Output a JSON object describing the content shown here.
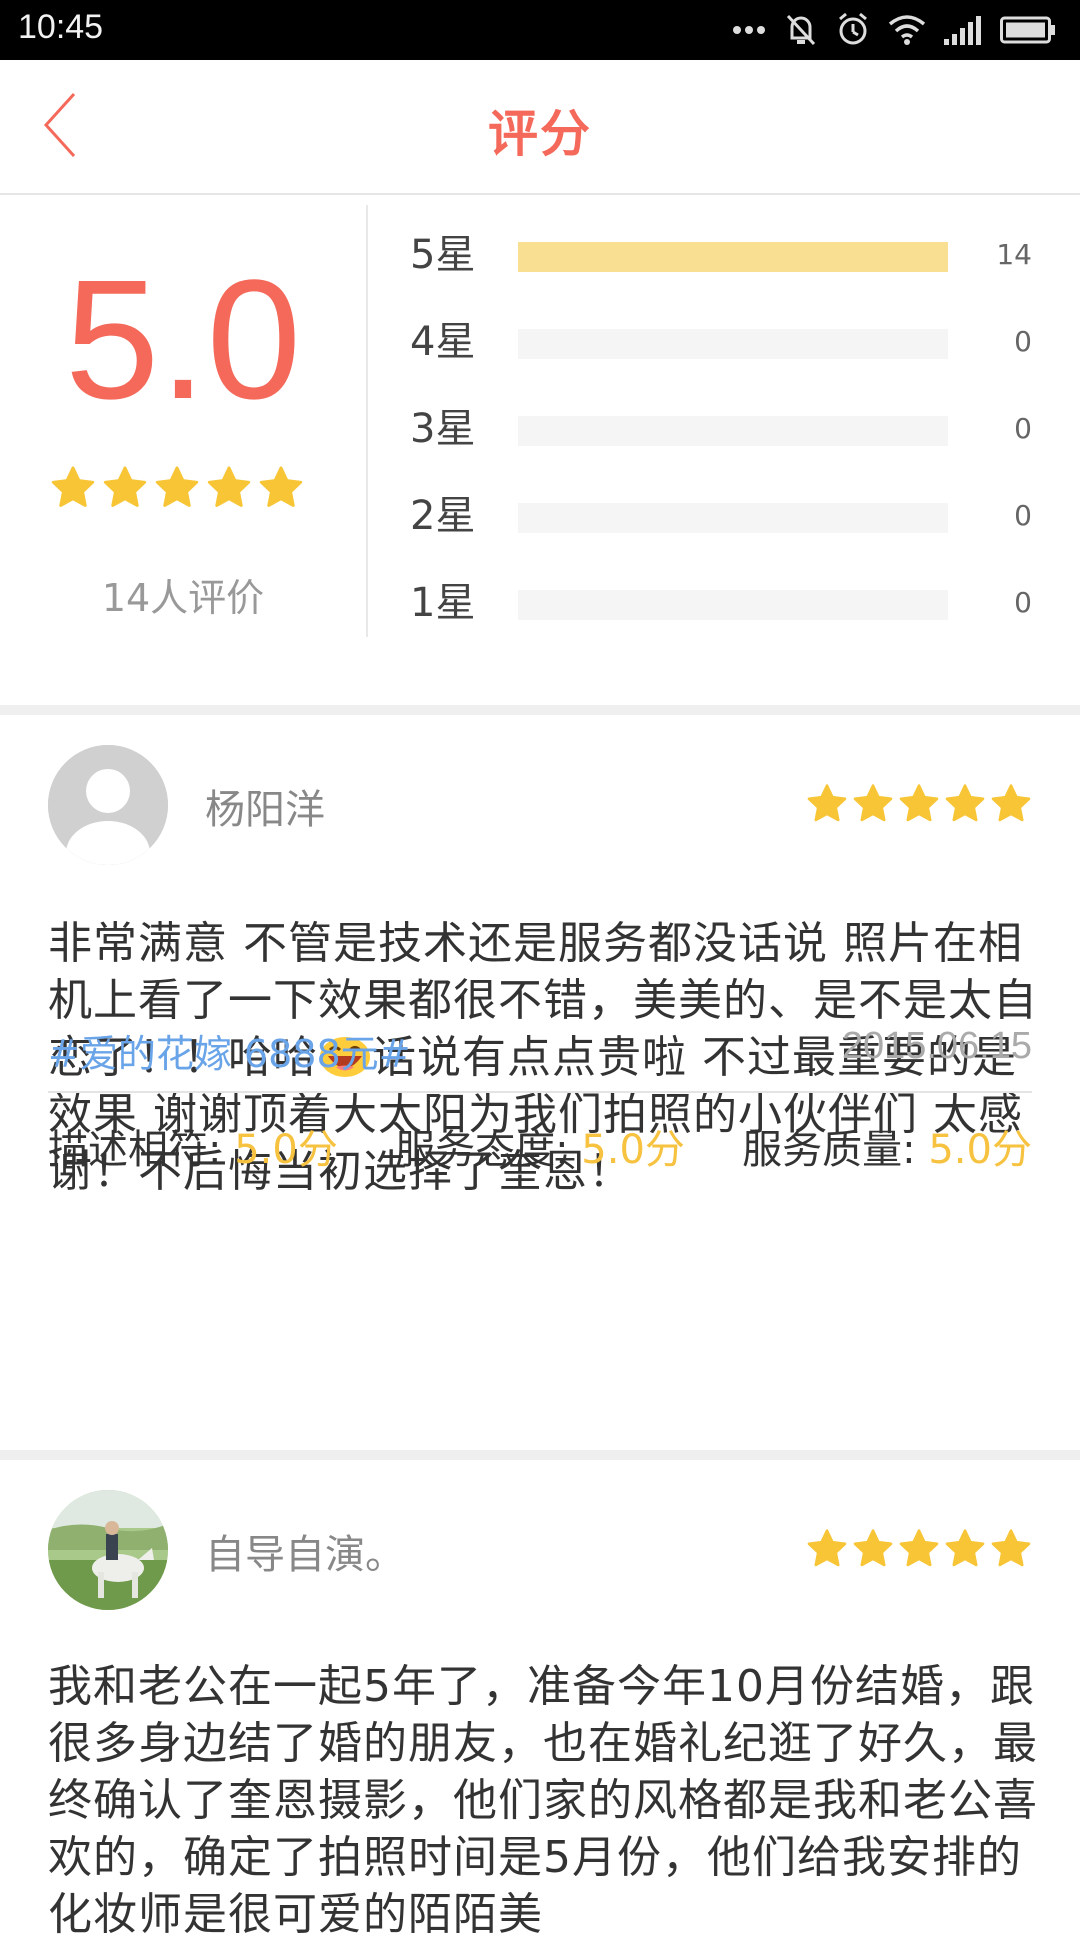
{
  "status_bar": {
    "time": "10:45"
  },
  "header": {
    "title": "评分"
  },
  "summary": {
    "average": "5.0",
    "review_count_text": "14人评价",
    "distribution": [
      {
        "label": "5星",
        "count": "14",
        "fraction": 1.0
      },
      {
        "label": "4星",
        "count": "0",
        "fraction": 0
      },
      {
        "label": "3星",
        "count": "0",
        "fraction": 0
      },
      {
        "label": "2星",
        "count": "0",
        "fraction": 0
      },
      {
        "label": "1星",
        "count": "0",
        "fraction": 0
      }
    ]
  },
  "reviews": [
    {
      "name": "杨阳洋",
      "stars": 5,
      "text_part1": "非常满意 不管是技术还是服务都没话说 照片在相机上看了一下效果都很不错，美美的、是不是太自恋了！！哈哈",
      "emoji": "laughing-emoji",
      "text_part2": "话说有点点贵啦 不过最重要的是效果 谢谢顶着大太阳为我们拍照的小伙伴们 太感谢！不后悔当初选择了奎恩！",
      "package": "#爱的花嫁 6888元#",
      "date": "2015.06.15",
      "subscores": [
        {
          "label": "描述相符: ",
          "value": "5.0分"
        },
        {
          "label": "服务态度: ",
          "value": "5.0分"
        },
        {
          "label": "服务质量: ",
          "value": "5.0分"
        }
      ]
    },
    {
      "name": "自导自演。",
      "stars": 5,
      "text": "我和老公在一起5年了，准备今年10月份结婚，跟很多身边结了婚的朋友，也在婚礼纪逛了好久，最终确认了奎恩摄影，他们家的风格都是我和老公喜欢的，确定了拍照时间是5月份，他们给我安排的化妆师是很可爱的陌陌美"
    }
  ],
  "colors": {
    "accent": "#f4695a",
    "star": "#f7c535",
    "bar_fill": "#f9df91",
    "tag": "#6aa4e8"
  }
}
